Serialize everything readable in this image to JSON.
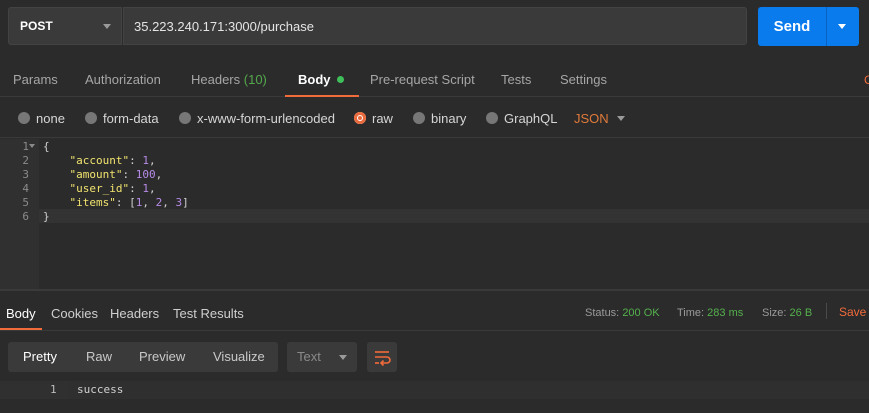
{
  "request": {
    "method": "POST",
    "url": "35.223.240.171:3000/purchase",
    "send_label": "Send"
  },
  "tabs": [
    {
      "label": "Params"
    },
    {
      "label": "Authorization"
    },
    {
      "label": "Headers",
      "count": "(10)"
    },
    {
      "label": "Body"
    },
    {
      "label": "Pre-request Script"
    },
    {
      "label": "Tests"
    },
    {
      "label": "Settings"
    }
  ],
  "tab_edge": "C",
  "body_types": [
    "none",
    "form-data",
    "x-www-form-urlencoded",
    "raw",
    "binary",
    "GraphQL"
  ],
  "body_format": "JSON",
  "editor": {
    "line_numbers": [
      "1",
      "2",
      "3",
      "4",
      "5",
      "6"
    ],
    "lines": [
      {
        "open": "{"
      },
      {
        "key": "\"account\"",
        "value": "1",
        "suffix": ","
      },
      {
        "key": "\"amount\"",
        "value": "100",
        "suffix": ","
      },
      {
        "key": "\"user_id\"",
        "value": "1",
        "suffix": ","
      },
      {
        "key": "\"items\"",
        "array": [
          "1",
          "2",
          "3"
        ]
      },
      {
        "close": "}"
      }
    ]
  },
  "response": {
    "tabs": [
      "Body",
      "Cookies",
      "Headers",
      "Test Results"
    ],
    "status_label": "Status:",
    "status_value": "200 OK",
    "time_label": "Time:",
    "time_value": "283 ms",
    "size_label": "Size:",
    "size_value": "26 B",
    "save_label": "Save",
    "formats": [
      "Pretty",
      "Raw",
      "Preview",
      "Visualize"
    ],
    "type_select": "Text",
    "line_number": "1",
    "body_text": "success"
  },
  "colors": {
    "accent": "#f26b3a",
    "send": "#097bed",
    "status_ok": "#54b14c"
  }
}
